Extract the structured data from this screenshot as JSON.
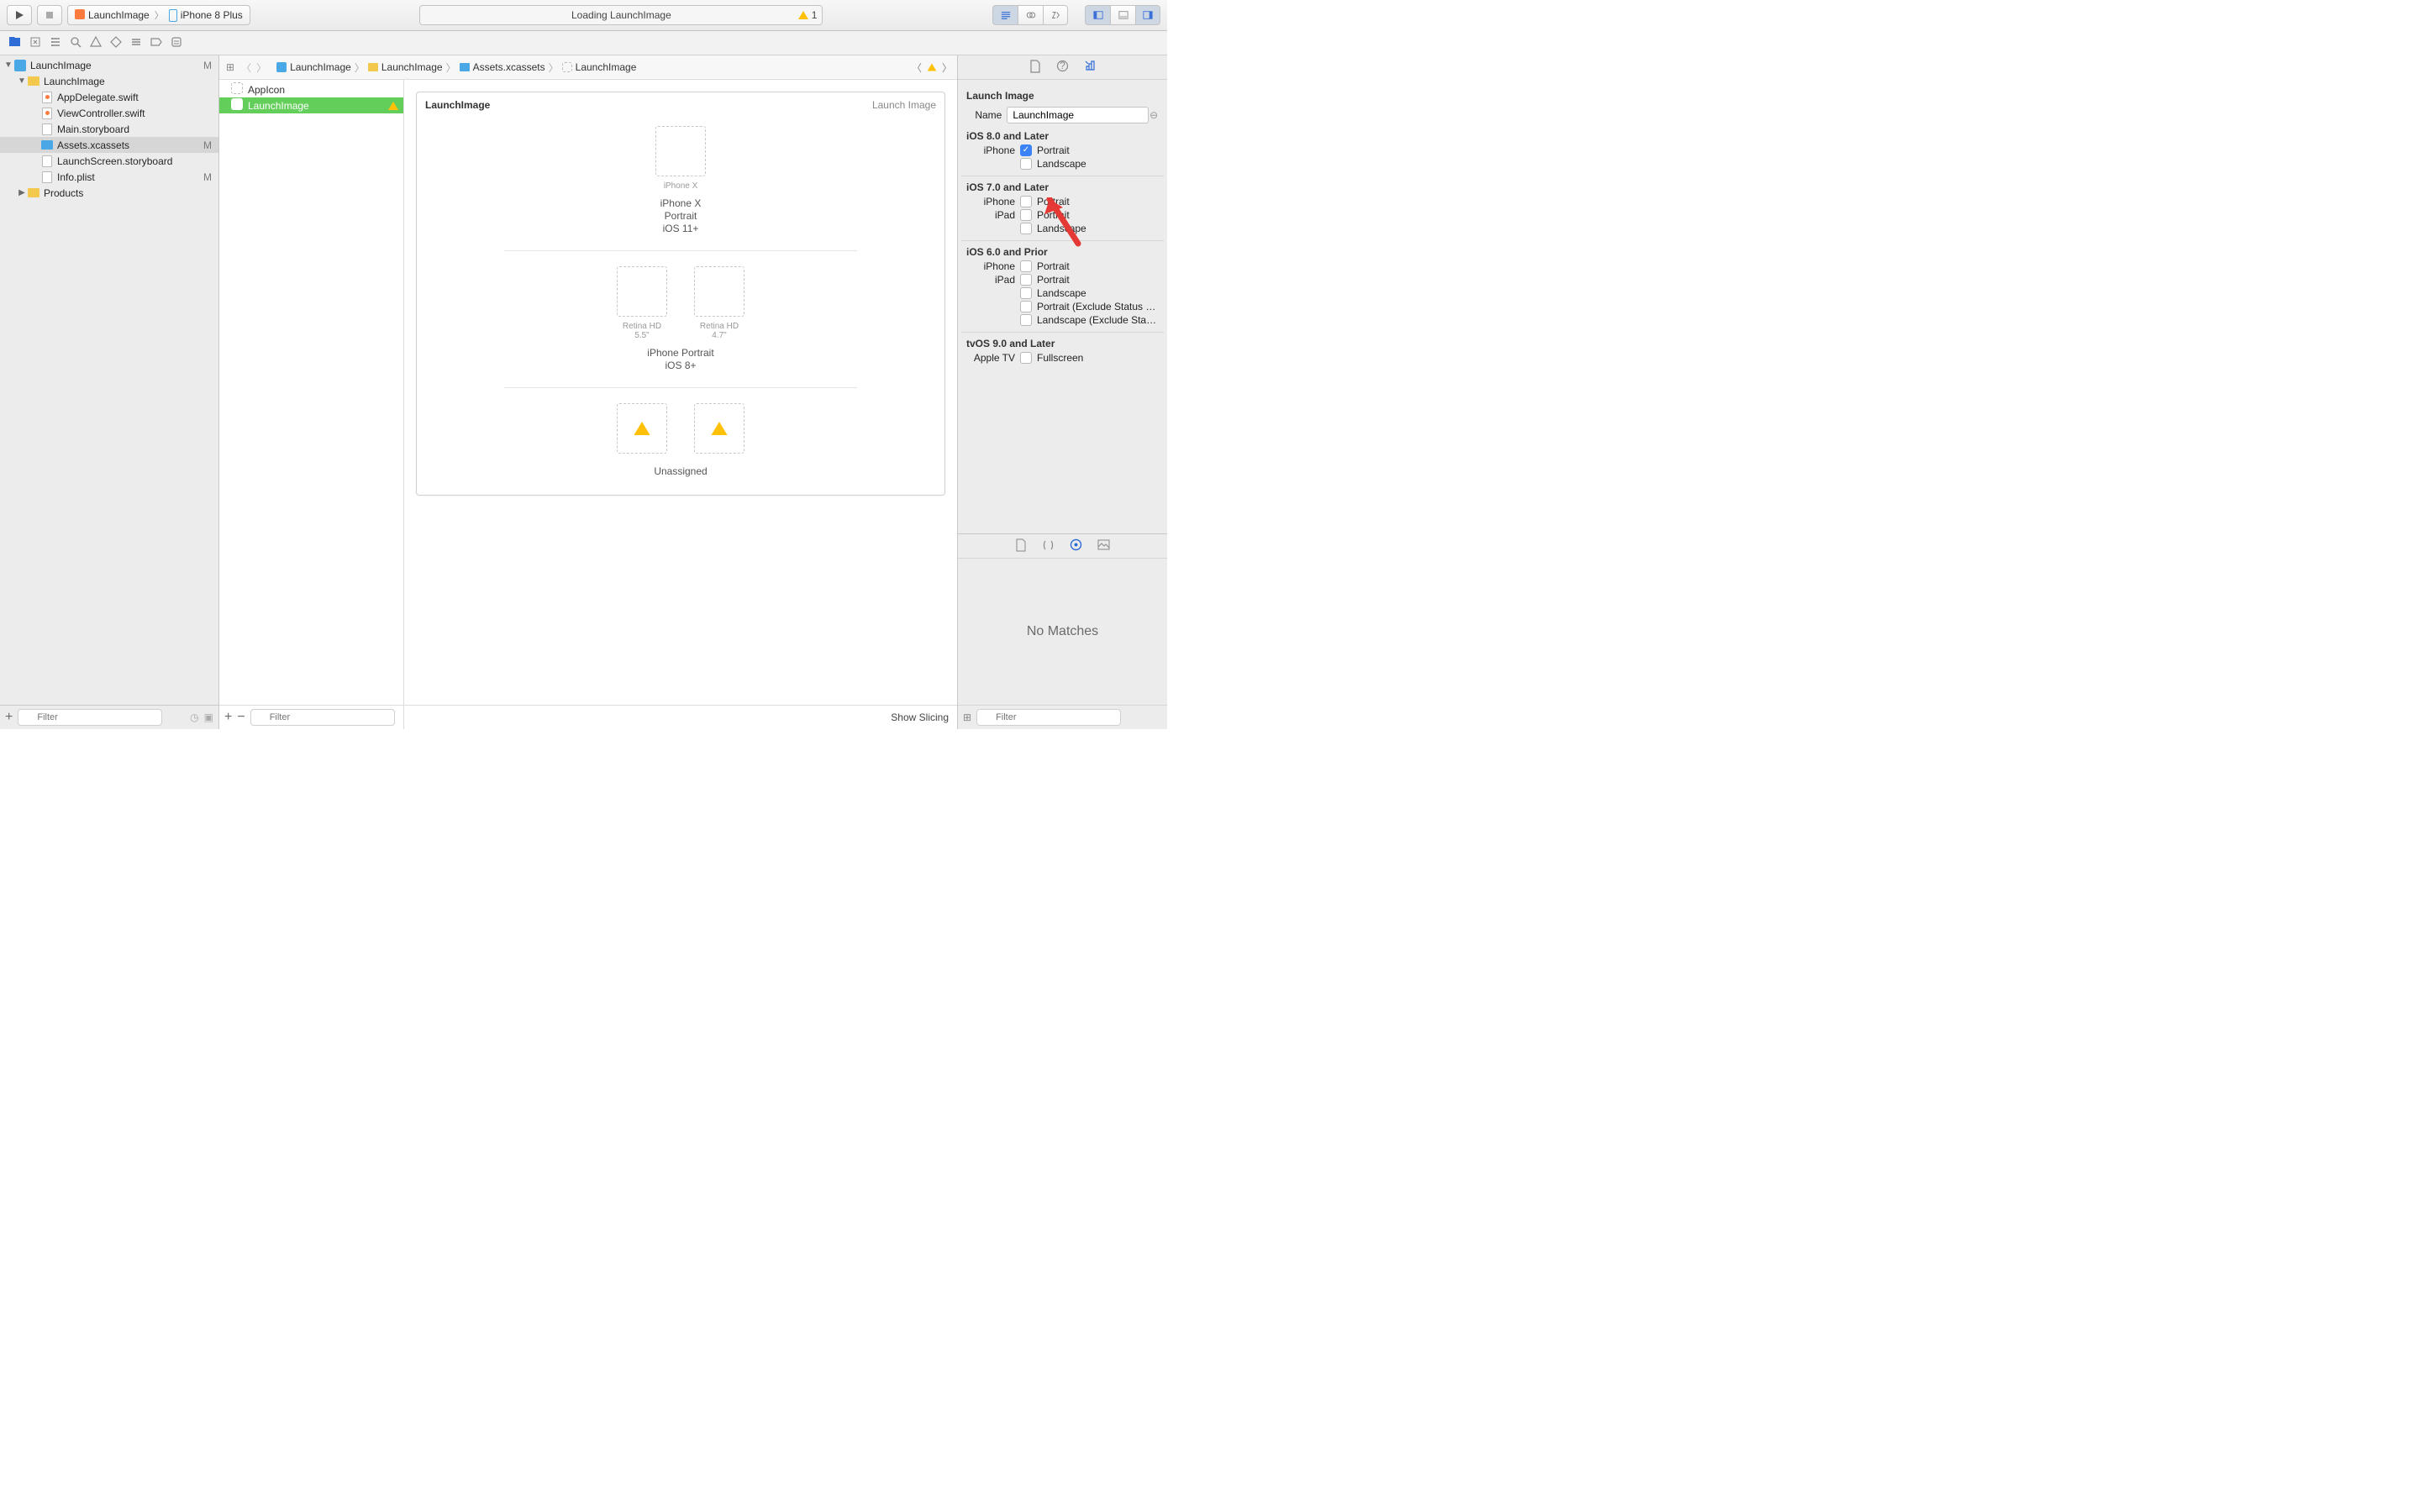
{
  "toolbar": {
    "scheme_target": "LaunchImage",
    "scheme_device": "iPhone 8 Plus",
    "status_text": "Loading LaunchImage",
    "warning_count": "1"
  },
  "breadcrumb": [
    "LaunchImage",
    "LaunchImage",
    "Assets.xcassets",
    "LaunchImage"
  ],
  "tree": [
    {
      "indent": 0,
      "label": "LaunchImage",
      "mod": "M",
      "disc": "▼",
      "icon": "proj"
    },
    {
      "indent": 1,
      "label": "LaunchImage",
      "disc": "▼",
      "icon": "folder-yellow"
    },
    {
      "indent": 2,
      "label": "AppDelegate.swift",
      "icon": "swift"
    },
    {
      "indent": 2,
      "label": "ViewController.swift",
      "icon": "swift"
    },
    {
      "indent": 2,
      "label": "Main.storyboard",
      "icon": "file"
    },
    {
      "indent": 2,
      "label": "Assets.xcassets",
      "mod": "M",
      "icon": "folder-blue",
      "selected": true
    },
    {
      "indent": 2,
      "label": "LaunchScreen.storyboard",
      "icon": "file"
    },
    {
      "indent": 2,
      "label": "Info.plist",
      "mod": "M",
      "icon": "file"
    },
    {
      "indent": 1,
      "label": "Products",
      "disc": "▶",
      "icon": "folder-yellow"
    }
  ],
  "asset_list": [
    {
      "label": "AppIcon",
      "icon": "app"
    },
    {
      "label": "LaunchImage",
      "icon": "launch",
      "selected": true,
      "warn": true
    }
  ],
  "canvas": {
    "card_title": "LaunchImage",
    "card_sub": "Launch Image",
    "groups": [
      {
        "slots": [
          {
            "label": "iPhone X"
          }
        ],
        "caption": "iPhone X\nPortrait\niOS 11+"
      },
      {
        "slots": [
          {
            "label": "Retina HD 5.5\""
          },
          {
            "label": "Retina HD 4.7\""
          }
        ],
        "caption": "iPhone Portrait\niOS 8+"
      },
      {
        "slots": [
          {
            "label": "",
            "warn": true
          },
          {
            "label": "",
            "warn": true
          }
        ],
        "caption": "Unassigned"
      }
    ],
    "show_slicing": "Show Slicing"
  },
  "inspector": {
    "title": "Launch Image",
    "name_label": "Name",
    "name_value": "LaunchImage",
    "groups": [
      {
        "title": "iOS 8.0 and Later",
        "rows": [
          {
            "device": "iPhone",
            "label": "Portrait",
            "checked": true
          },
          {
            "device": "",
            "label": "Landscape"
          }
        ]
      },
      {
        "title": "iOS 7.0 and Later",
        "rows": [
          {
            "device": "iPhone",
            "label": "Portrait"
          },
          {
            "device": "iPad",
            "label": "Portrait"
          },
          {
            "device": "",
            "label": "Landscape"
          }
        ]
      },
      {
        "title": "iOS 6.0 and Prior",
        "rows": [
          {
            "device": "iPhone",
            "label": "Portrait"
          },
          {
            "device": "iPad",
            "label": "Portrait"
          },
          {
            "device": "",
            "label": "Landscape"
          },
          {
            "device": "",
            "label": "Portrait (Exclude Status Bar)"
          },
          {
            "device": "",
            "label": "Landscape (Exclude Status…"
          }
        ]
      },
      {
        "title": "tvOS 9.0 and Later",
        "rows": [
          {
            "device": "Apple TV",
            "label": "Fullscreen"
          }
        ]
      }
    ]
  },
  "library": {
    "no_matches": "No Matches"
  },
  "filter_placeholder": "Filter"
}
